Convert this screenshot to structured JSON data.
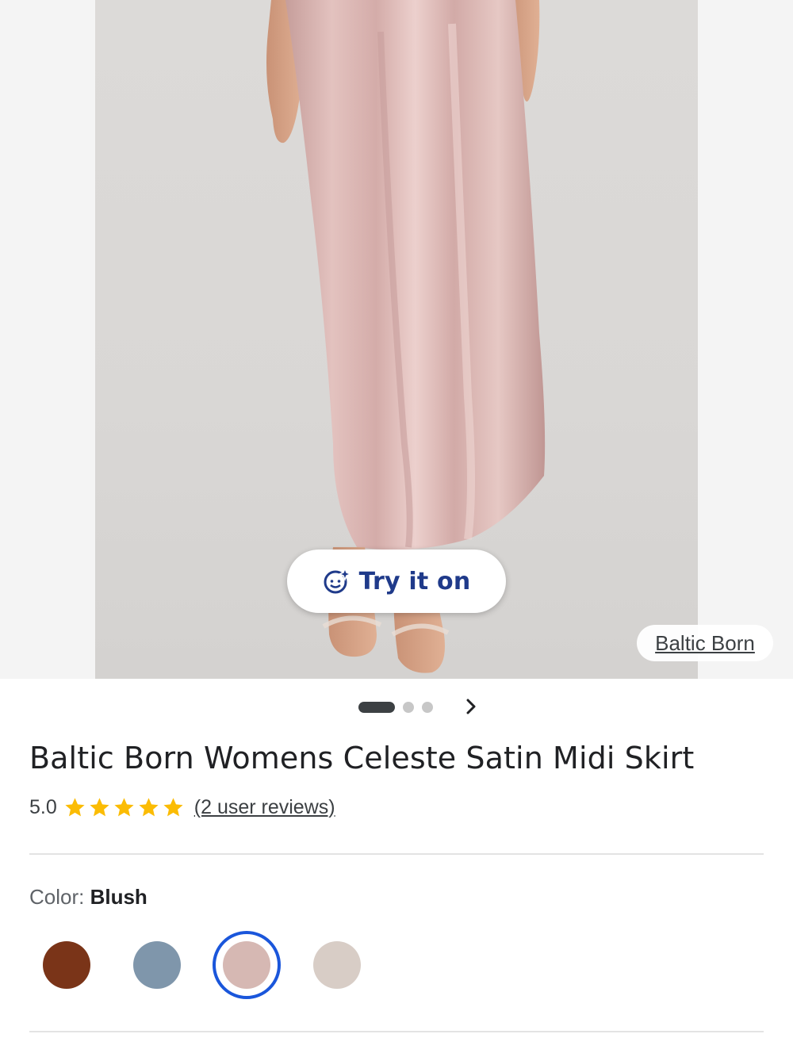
{
  "try_on": {
    "label": "Try it on",
    "icon": "face-sparkle-icon"
  },
  "source_chip": {
    "label": "Baltic Born"
  },
  "carousel": {
    "total": 3,
    "active": 1,
    "next_icon": "chevron-right-icon"
  },
  "product": {
    "title": "Baltic Born Womens Celeste Satin Midi Skirt",
    "rating": "5.0",
    "stars": 5,
    "reviews_link": "(2 user reviews)"
  },
  "color": {
    "label": "Color: ",
    "selected": "Blush",
    "swatches": [
      {
        "hex": "#7a3418"
      },
      {
        "hex": "#7f96ab"
      },
      {
        "hex": "#d6b8b3",
        "selected": true
      },
      {
        "hex": "#d8cdc6"
      }
    ]
  },
  "colors": {
    "star": "#fbbc04",
    "accent": "#1a56db",
    "try_on_text": "#1f3a8a",
    "skirt": "#d9b4b1"
  }
}
